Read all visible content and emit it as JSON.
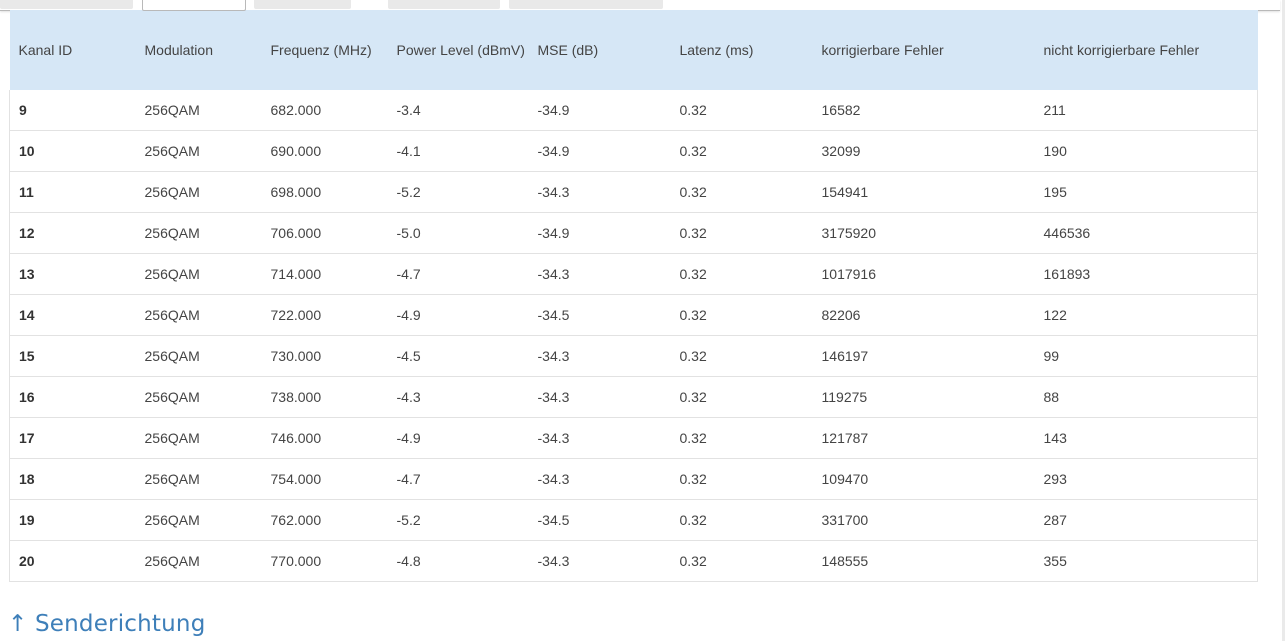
{
  "section": {
    "heading": "↑ Senderichtung"
  },
  "table": {
    "headers": [
      "Kanal ID",
      "Modulation",
      "Frequenz (MHz)",
      "Power Level (dBmV)",
      "MSE (dB)",
      "Latenz (ms)",
      "korrigierbare Fehler",
      "nicht korrigierbare Fehler"
    ],
    "rows": [
      [
        "9",
        "256QAM",
        "682.000",
        "-3.4",
        "-34.9",
        "0.32",
        "16582",
        "211"
      ],
      [
        "10",
        "256QAM",
        "690.000",
        "-4.1",
        "-34.9",
        "0.32",
        "32099",
        "190"
      ],
      [
        "11",
        "256QAM",
        "698.000",
        "-5.2",
        "-34.3",
        "0.32",
        "154941",
        "195"
      ],
      [
        "12",
        "256QAM",
        "706.000",
        "-5.0",
        "-34.9",
        "0.32",
        "3175920",
        "446536"
      ],
      [
        "13",
        "256QAM",
        "714.000",
        "-4.7",
        "-34.3",
        "0.32",
        "1017916",
        "161893"
      ],
      [
        "14",
        "256QAM",
        "722.000",
        "-4.9",
        "-34.5",
        "0.32",
        "82206",
        "122"
      ],
      [
        "15",
        "256QAM",
        "730.000",
        "-4.5",
        "-34.3",
        "0.32",
        "146197",
        "99"
      ],
      [
        "16",
        "256QAM",
        "738.000",
        "-4.3",
        "-34.3",
        "0.32",
        "119275",
        "88"
      ],
      [
        "17",
        "256QAM",
        "746.000",
        "-4.9",
        "-34.3",
        "0.32",
        "121787",
        "143"
      ],
      [
        "18",
        "256QAM",
        "754.000",
        "-4.7",
        "-34.3",
        "0.32",
        "109470",
        "293"
      ],
      [
        "19",
        "256QAM",
        "762.000",
        "-5.2",
        "-34.5",
        "0.32",
        "331700",
        "287"
      ],
      [
        "20",
        "256QAM",
        "770.000",
        "-4.8",
        "-34.3",
        "0.32",
        "148555",
        "355"
      ]
    ]
  },
  "colors": {
    "header_bg": "#d6e7f6",
    "heading_accent": "#3e7fb9"
  }
}
